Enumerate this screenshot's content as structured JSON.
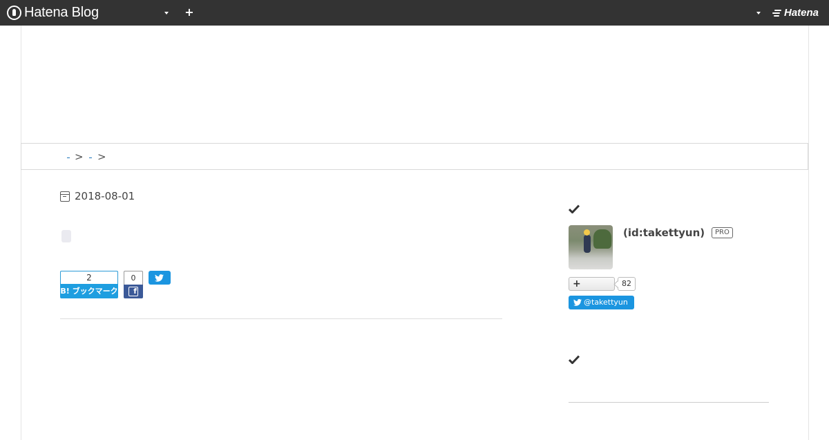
{
  "header": {
    "brand": "Hatena Blog",
    "hatena_label": "Hatena"
  },
  "article": {
    "date": "2018-08-01",
    "share": {
      "hatena_bookmark_count": "2",
      "hatena_bookmark_label": "B! ブックマーク",
      "facebook_count": "0",
      "facebook_glyph": "f"
    }
  },
  "sidebar": {
    "profile": {
      "name": "(id:takettyun)",
      "badge": "PRO",
      "subscribe_glyph": "+",
      "subscriber_count": "82",
      "twitter_follow": "@takettyun"
    }
  },
  "icons": {
    "calendar": "calendar-icon",
    "check": "check-icon",
    "twitter": "twitter-bird-icon",
    "plus": "plus-icon"
  },
  "colors": {
    "topbar": "#333333",
    "hatena_bookmark": "#1e9ee0",
    "facebook": "#3b5998",
    "twitter": "#1b95e0"
  }
}
